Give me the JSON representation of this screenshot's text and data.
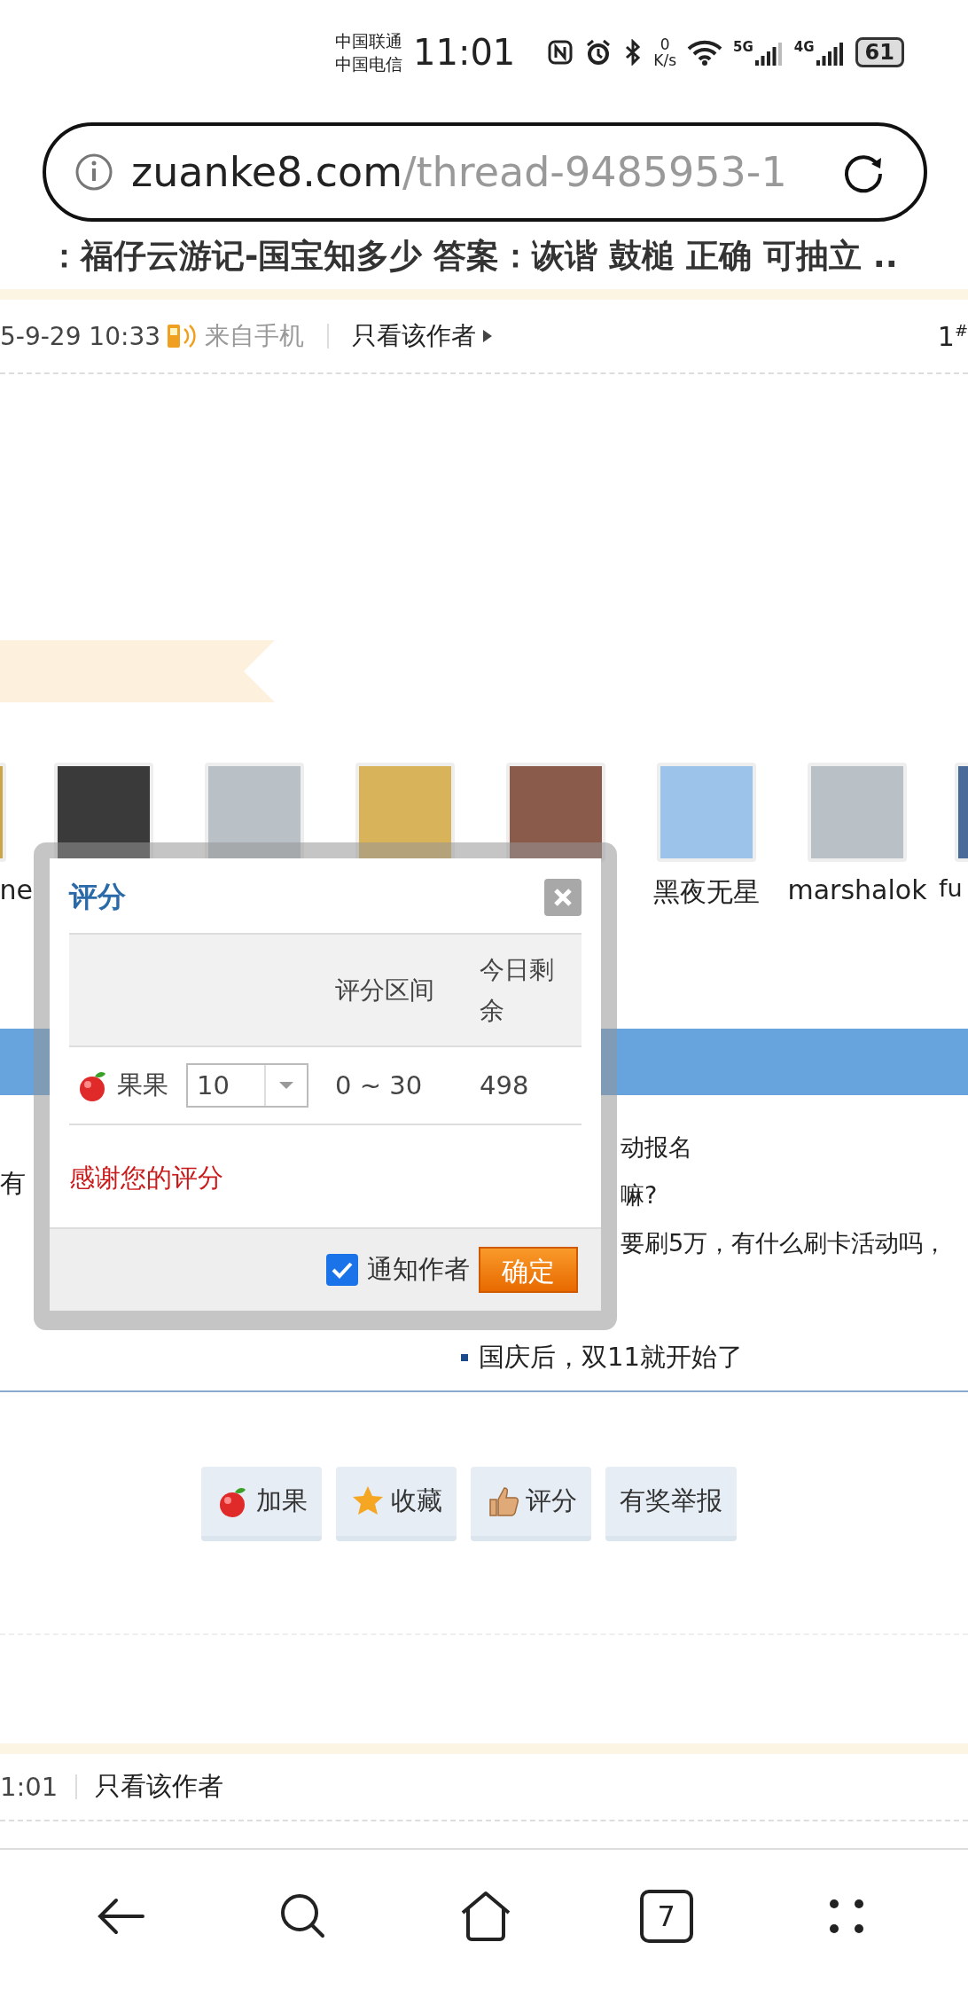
{
  "status_bar": {
    "carriers": [
      "中国联通",
      "中国电信"
    ],
    "time": "11:01",
    "net_speed": [
      "0",
      "K/s"
    ],
    "network_labels": [
      "5G",
      "4G"
    ],
    "battery": "61"
  },
  "address_bar": {
    "domain": "zuanke8.com",
    "path": "/thread-9485953-1"
  },
  "headline": "：福仔云游记-国宝知多少 答案：诙谐 鼓槌 正确 可抽立 ..",
  "post_header": {
    "time": "5-9-29 10:33",
    "source": "来自手机",
    "author_only": "只看该作者",
    "floor": "1",
    "floor_mark": "#"
  },
  "rater_names": {
    "left_cut": "ne",
    "visible": [
      "黑夜无星",
      "marshalok"
    ],
    "right_cut": "fu"
  },
  "thread_list": {
    "left_fragment": "有",
    "lines": [
      "动报名",
      "嘛?",
      "要刷5万，有什么刷卡活动吗，"
    ],
    "bullet": "国庆后，双11就开始了"
  },
  "rate_dialog": {
    "title": "评分",
    "columns": [
      "评分区间",
      "今日剩余"
    ],
    "rows": [
      {
        "label": "果果",
        "value": "10",
        "range": "0 ~ 30",
        "remaining": "498"
      }
    ],
    "message": "感谢您的评分",
    "notify": {
      "label": "通知作者",
      "checked": true
    },
    "submit": "确定"
  },
  "actions": [
    {
      "kind": "apple",
      "label": "加果"
    },
    {
      "kind": "star",
      "label": "收藏"
    },
    {
      "kind": "thumb",
      "label": "评分"
    },
    {
      "kind": "plain",
      "label": "有奖举报"
    }
  ],
  "next_post": {
    "time": "1:01",
    "author_only": "只看该作者"
  },
  "nav": {
    "tabs_count": "7"
  }
}
